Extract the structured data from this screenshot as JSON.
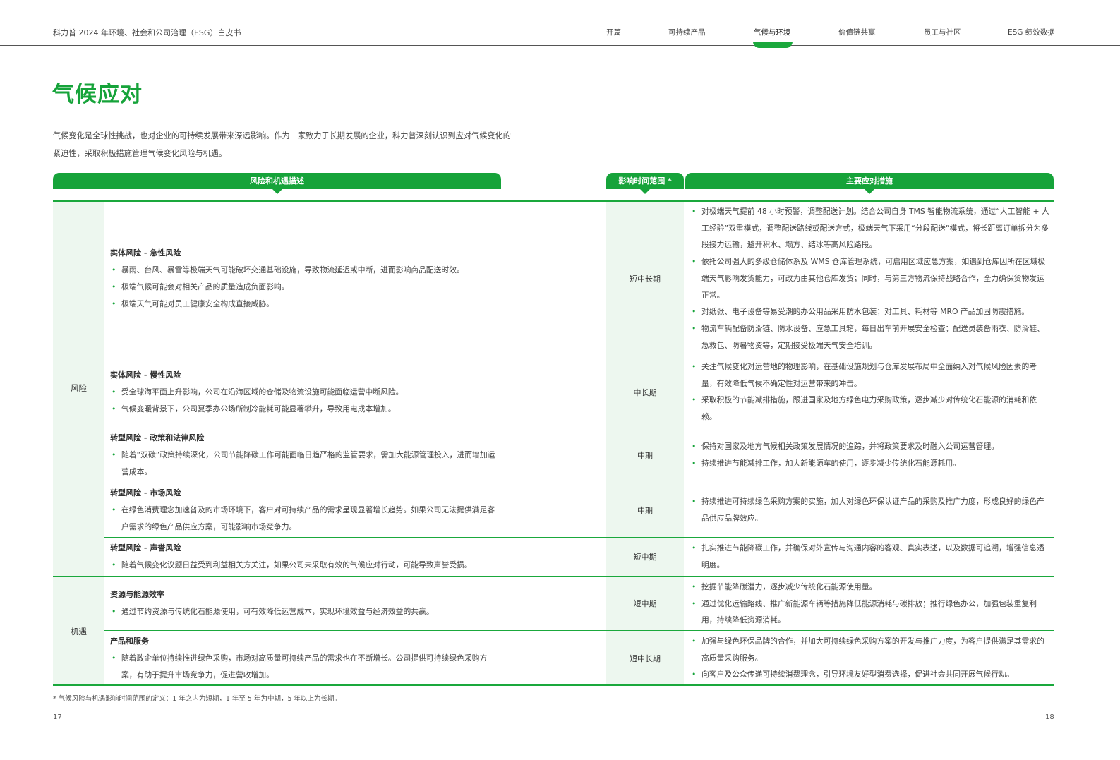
{
  "header": {
    "doc_title": "科力普 2024 年环境、社会和公司治理（ESG）白皮书",
    "nav": [
      "开篇",
      "可持续产品",
      "气候与环境",
      "价值链共赢",
      "员工与社区",
      "ESG 绩效数据"
    ]
  },
  "page_title": "气候应对",
  "intro": "气候变化是全球性挑战，也对企业的可持续发展带来深远影响。作为一家致力于长期发展的企业，科力普深刻认识到应对气候变化的紧迫性，采取积极措施管理气候变化风险与机遇。",
  "table": {
    "headers": [
      "风险和机遇描述",
      "影响时间范围 *",
      "主要应对措施"
    ],
    "categories": [
      "风险",
      "机遇"
    ],
    "rows": [
      {
        "title": "实体风险 - 急性风险",
        "items": [
          "暴雨、台风、暴雪等极端天气可能破坏交通基础设施，导致物流延迟或中断，进而影响商品配送时效。",
          "极端气候可能会对相关产品的质量造成负面影响。",
          "极端天气可能对员工健康安全构成直接威胁。"
        ],
        "time": "短中长期",
        "measures": [
          "对极端天气提前 48 小时预警，调整配送计划。结合公司自身 TMS 智能物流系统，通过“人工智能 + 人工经验”双重模式，调整配送路线或配送方式，极端天气下采用“分段配送”模式，将长距离订单拆分为多段接力运输，避开积水、塌方、结冰等高风险路段。",
          "依托公司强大的多级仓储体系及 WMS 仓库管理系统，可启用区域应急方案，如遇到仓库因所在区域极端天气影响发货能力，可改为由其他仓库发货；同时，与第三方物流保持战略合作，全力确保货物发运正常。",
          "对纸张、电子设备等易受潮的办公用品采用防水包装；对工具、耗材等 MRO 产品加固防震措施。",
          "物流车辆配备防滑链、防水设备、应急工具箱，每日出车前开展安全检查；配送员装备雨衣、防滑鞋、急救包、防暑物资等，定期接受极端天气安全培训。"
        ]
      },
      {
        "title": "实体风险 - 慢性风险",
        "items": [
          "受全球海平面上升影响，公司在沿海区域的仓储及物流设施可能面临运营中断风险。",
          "气候变暖背景下，公司夏季办公场所制冷能耗可能显著攀升，导致用电成本增加。"
        ],
        "time": "中长期",
        "measures": [
          "关注气候变化对运营地的物理影响，在基础设施规划与仓库发展布局中全面纳入对气候风险因素的考量，有效降低气候不确定性对运营带来的冲击。",
          "采取积极的节能减排措施，跟进国家及地方绿色电力采购政策，逐步减少对传统化石能源的消耗和依赖。"
        ]
      },
      {
        "title": "转型风险 - 政策和法律风险",
        "items": [
          "随着“双碳”政策持续深化，公司节能降碳工作可能面临日趋严格的监管要求，需加大能源管理投入，进而增加运营成本。"
        ],
        "time": "中期",
        "measures": [
          "保持对国家及地方气候相关政策发展情况的追踪，并将政策要求及时融入公司运营管理。",
          "持续推进节能减排工作，加大新能源车的使用，逐步减少传统化石能源耗用。"
        ]
      },
      {
        "title": "转型风险 - 市场风险",
        "items": [
          "在绿色消费理念加速普及的市场环境下，客户对可持续产品的需求呈现显著增长趋势。如果公司无法提供满足客户需求的绿色产品供应方案，可能影响市场竞争力。"
        ],
        "time": "中期",
        "measures": [
          "持续推进可持续绿色采购方案的实施，加大对绿色环保认证产品的采购及推广力度，形成良好的绿色产品供应品牌效应。"
        ]
      },
      {
        "title": "转型风险 - 声誉风险",
        "items": [
          "随着气候变化议题日益受到利益相关方关注，如果公司未采取有效的气候应对行动，可能导致声誉受损。"
        ],
        "time": "短中期",
        "measures": [
          "扎实推进节能降碳工作，并确保对外宣传与沟通内容的客观、真实表述，以及数据可追溯，增强信息透明度。"
        ]
      },
      {
        "title": "资源与能源效率",
        "items": [
          "通过节约资源与传统化石能源使用，可有效降低运营成本，实现环境效益与经济效益的共赢。"
        ],
        "time": "短中期",
        "measures": [
          "挖掘节能降碳潜力，逐步减少传统化石能源使用量。",
          "通过优化运输路线、推广新能源车辆等措施降低能源消耗与碳排放；推行绿色办公，加强包装重复利用，持续降低资源消耗。"
        ]
      },
      {
        "title": "产品和服务",
        "items": [
          "随着政企单位持续推进绿色采购，市场对高质量可持续产品的需求也在不断增长。公司提供可持续绿色采购方案，有助于提升市场竞争力，促进营收增加。"
        ],
        "time": "短中长期",
        "measures": [
          "加强与绿色环保品牌的合作，并加大可持续绿色采购方案的开发与推广力度，为客户提供满足其需求的高质量采购服务。",
          "向客户及公众传递可持续消费理念，引导环境友好型消费选择，促进社会共同开展气候行动。"
        ]
      }
    ]
  },
  "footnote": "* 气候风险与机遇影响时间范围的定义：1 年之内为短期，1 年至 5 年为中期，5 年以上为长期。",
  "page_left": "17",
  "page_right": "18",
  "colors": {
    "accent": "#16a33a",
    "shade": "#edf7ef"
  }
}
